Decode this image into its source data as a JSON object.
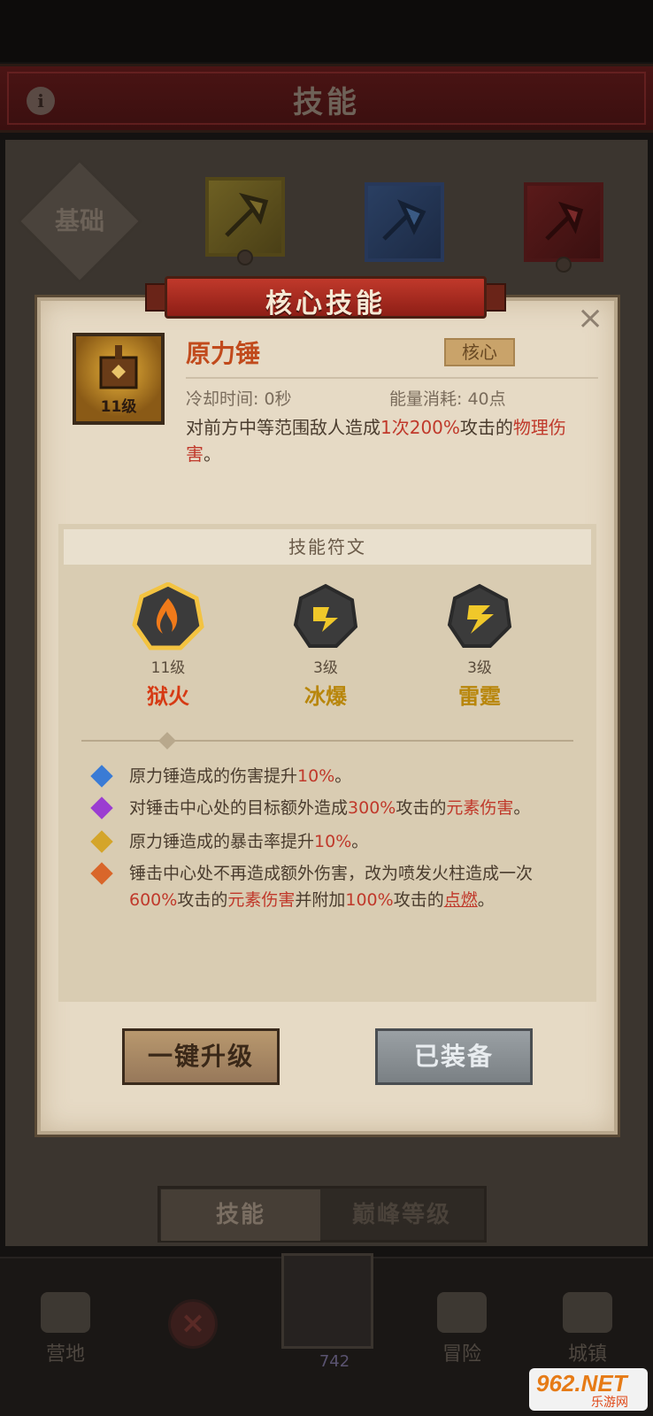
{
  "screen": {
    "title": "技能",
    "base_label": "基础"
  },
  "tabs": [
    {
      "label": "技能"
    },
    {
      "label": "巅峰等级"
    }
  ],
  "bottom_nav": [
    {
      "label": "营地",
      "icon": "tent-icon"
    },
    {
      "label": "冒险",
      "icon": "map-icon"
    },
    {
      "label": "城镇",
      "icon": "castle-icon"
    }
  ],
  "center_slot": {
    "count": "742"
  },
  "modal": {
    "title": "核心技能",
    "skill": {
      "name": "原力锤",
      "tag": "核心",
      "level": "11级",
      "cooldown": "冷却时间: 0秒",
      "energy": "能量消耗: 40点",
      "desc_parts": [
        "对前方中等范围敌人造成",
        "1次",
        "200%",
        "攻击的",
        "物理伤害",
        "。"
      ]
    },
    "rune_section_title": "技能符文",
    "runes": [
      {
        "level": "11级",
        "name": "狱火",
        "style": "fire"
      },
      {
        "level": "3级",
        "name": "冰爆",
        "style": "yellow"
      },
      {
        "level": "3级",
        "name": "雷霆",
        "style": "yellow"
      }
    ],
    "effects": [
      {
        "gem_color": "#3a7bd5",
        "parts": [
          "原力锤造成的伤害提升",
          "10%",
          "。"
        ]
      },
      {
        "gem_color": "#9b3dd1",
        "parts": [
          "对锤击中心处的目标额外造成",
          "300%",
          "攻击的",
          "元素伤害",
          "。"
        ]
      },
      {
        "gem_color": "#d4a52a",
        "parts": [
          "原力锤造成的暴击率提升",
          "10%",
          "。"
        ]
      },
      {
        "gem_color": "#d9662a",
        "line1": "锤击中心处不再造成额外伤害，改为喷发火柱造成一次",
        "line2_parts": [
          "600%",
          "攻击的",
          "元素伤害",
          "并附加",
          "100%",
          "攻击的",
          "点燃",
          "。"
        ]
      }
    ],
    "buttons": {
      "upgrade": "一键升级",
      "equipped": "已装备"
    }
  },
  "watermark": {
    "brand": "962.NET",
    "sub": "乐游网"
  }
}
